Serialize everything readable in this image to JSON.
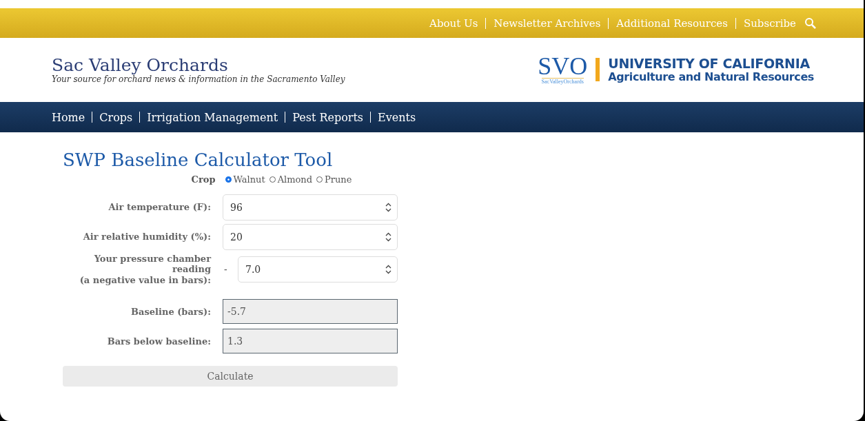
{
  "top_links": [
    "About Us",
    "Newsletter Archives",
    "Additional Resources",
    "Subscribe"
  ],
  "site": {
    "title": "Sac Valley Orchards",
    "tagline": "Your source for orchard news & information in the Sacramento Valley"
  },
  "logo": {
    "mark": "SVO",
    "mark_caption": "SacValleyOrchards",
    "org_line1": "UNIVERSITY OF CALIFORNIA",
    "org_line2": "Agriculture and Natural Resources"
  },
  "nav": [
    "Home",
    "Crops",
    "Irrigation Management",
    "Pest Reports",
    "Events"
  ],
  "tool": {
    "title": "SWP Baseline Calculator Tool",
    "crop_label": "Crop",
    "crops": [
      {
        "label": "Walnut",
        "selected": true
      },
      {
        "label": "Almond",
        "selected": false
      },
      {
        "label": "Prune",
        "selected": false
      }
    ],
    "inputs": [
      {
        "label": "Air temperature (F):",
        "value": "96"
      },
      {
        "label": "Air relative humidity (%):",
        "value": "20"
      },
      {
        "label": "Your pressure chamber reading\n(a negative value in bars):",
        "prefix": "-",
        "value": "7.0"
      }
    ],
    "outputs": [
      {
        "label": "Baseline (bars):",
        "value": "-5.7"
      },
      {
        "label": "Bars below baseline:",
        "value": "1.3"
      }
    ],
    "button": "Calculate"
  }
}
